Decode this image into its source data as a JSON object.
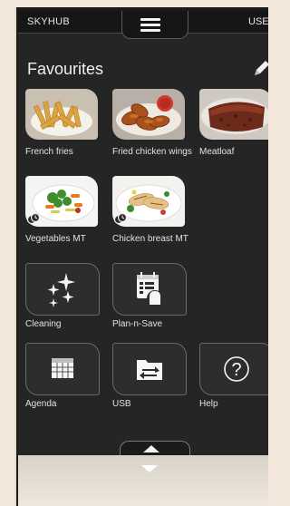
{
  "header": {
    "brand": "SKYHUB",
    "user": "USE",
    "menu_icon": "hamburger-icon"
  },
  "page": {
    "title": "Favourites",
    "edit_icon": "pencil-icon"
  },
  "favourites": [
    {
      "label": "French fries",
      "type": "photo"
    },
    {
      "label": "Fried chicken wings",
      "type": "photo"
    },
    {
      "label": "Meatloaf",
      "type": "photo"
    },
    {
      "label": "Vegetables MT",
      "type": "photo",
      "badge": "multi-timer-icon"
    },
    {
      "label": "Chicken breast MT",
      "type": "photo",
      "badge": "multi-timer-icon"
    }
  ],
  "functions": [
    {
      "label": "Cleaning",
      "icon": "sparkles-icon"
    },
    {
      "label": "Plan-n-Save",
      "icon": "plan-n-save-icon"
    },
    {
      "label": "Agenda",
      "icon": "calendar-icon"
    },
    {
      "label": "USB",
      "icon": "usb-transfer-icon"
    },
    {
      "label": "Help",
      "icon": "help-icon"
    }
  ],
  "footer": {
    "up_icon": "chevron-up-icon",
    "down_icon": "chevron-down-icon"
  }
}
